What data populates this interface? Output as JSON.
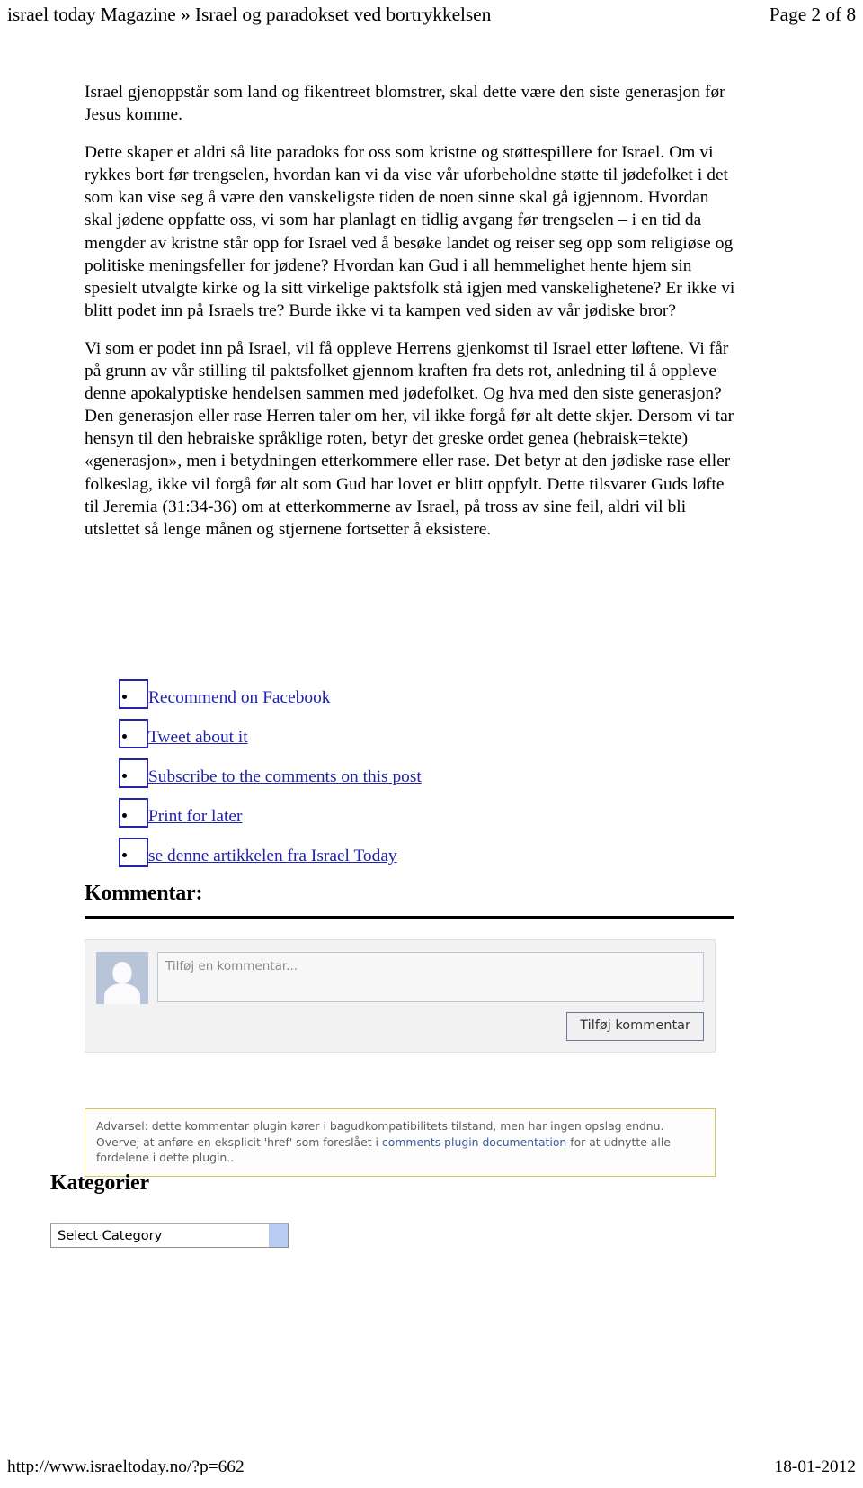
{
  "header": {
    "left_title": "israel today Magazine » Israel og paradokset ved bortrykkelsen",
    "right_page": "Page 2 of 8"
  },
  "article": {
    "paragraphs": [
      "Israel gjenoppstår som land og fikentreet blomstrer, skal dette være den siste generasjon før Jesus komme.",
      "Dette skaper et aldri så lite paradoks for oss som kristne og støttespillere for Israel. Om vi rykkes bort før trengselen, hvordan kan vi da vise vår uforbeholdne støtte til jødefolket i det som kan vise seg å være den vanskeligste tiden de noen sinne skal gå igjennom. Hvordan skal jødene oppfatte oss, vi som har planlagt en tidlig avgang før trengselen – i en tid da mengder av kristne står opp for Israel ved å besøke landet og reiser seg opp som religiøse og politiske meningsfeller for jødene? Hvordan kan Gud i all hemmelighet hente hjem sin spesielt utvalgte kirke og la sitt virkelige paktsfolk stå igjen med vanskelighetene? Er ikke vi blitt podet inn på Israels tre? Burde ikke vi ta kampen ved siden av vår jødiske bror?",
      "Vi som er podet inn på Israel, vil få oppleve Herrens gjenkomst til Israel etter løftene. Vi får på grunn av vår stilling til paktsfolket gjennom kraften fra dets rot, anledning til å oppleve denne apokalyptiske hendelsen sammen med jødefolket. Og hva med den siste generasjon? Den generasjon eller rase Herren taler om her, vil ikke forgå før alt dette skjer. Dersom vi tar hensyn til den hebraiske språklige roten, betyr det greske ordet genea (hebraisk=tekte) «generasjon», men i betydningen etterkommere eller rase. Det betyr at den jødiske rase eller folkeslag, ikke vil forgå før alt som Gud har lovet er blitt oppfylt. Dette tilsvarer Guds løfte til Jeremia (31:34-36) om at etterkommerne av Israel, på tross av sine feil, aldri vil bli utslettet så lenge månen og stjernene fortsetter å eksistere."
    ]
  },
  "share_links": [
    {
      "icon": "broken-image-icon",
      "label": "Recommend on Facebook"
    },
    {
      "icon": "broken-image-icon",
      "label": "Tweet about it"
    },
    {
      "icon": "broken-image-icon",
      "label": "Subscribe to the comments on this post"
    },
    {
      "icon": "broken-image-icon",
      "label": "Print for later"
    },
    {
      "icon": "broken-image-icon",
      "label": "se denne artikkelen fra Israel Today"
    }
  ],
  "comments": {
    "heading": "Kommentar:",
    "input_placeholder": "Tilføj en kommentar...",
    "submit_label": "Tilføj kommentar",
    "avatar_icon": "default-user-avatar-icon",
    "warning_prefix": "Advarsel: dette kommentar plugin kører i bagudkompatibilitets tilstand, men har ingen opslag endnu. Overvej at anføre en eksplicit 'href' som foreslået i ",
    "warning_link": "comments plugin documentation",
    "warning_suffix": " for at udnytte alle fordelene i dette plugin.."
  },
  "categories": {
    "heading": "Kategorier",
    "select_value": "Select Category",
    "dropdown_icon": "dropdown-arrow-icon"
  },
  "footer": {
    "url": "http://www.israeltoday.no/?p=662",
    "date": "18-01-2012"
  },
  "colors": {
    "link": "#2222aa",
    "fb_link": "#3b5998",
    "warning_border": "#d6c75a",
    "avatar_bg": "#b8c4d8",
    "select_arrow": "#b8cbf0"
  }
}
